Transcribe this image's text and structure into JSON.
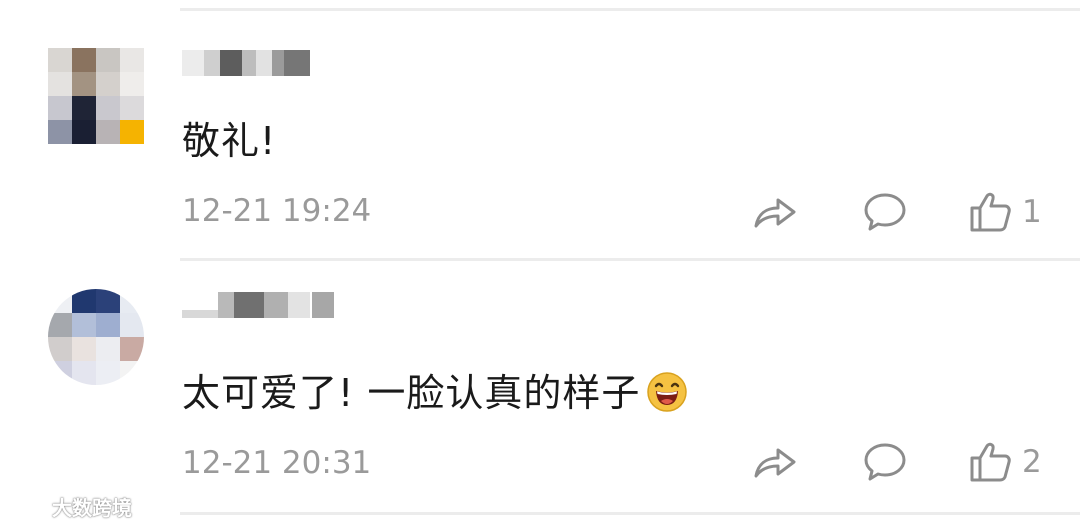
{
  "comments": [
    {
      "text": "敬礼!",
      "time": "12-21 19:24",
      "like_count": "1",
      "emoji": ""
    },
    {
      "text": "太可爱了! 一脸认真的样子",
      "time": "12-21 20:31",
      "like_count": "2",
      "emoji": "laughing-face"
    }
  ],
  "watermark": {
    "text": "大数跨境"
  },
  "icons": {
    "share": "share-arrow-icon",
    "comment": "comment-bubble-icon",
    "like": "thumbs-up-icon"
  },
  "colors": {
    "text": "#1a1a1a",
    "meta": "#9a9a9a",
    "divider": "#ececec",
    "emoji": "#f5c242"
  }
}
